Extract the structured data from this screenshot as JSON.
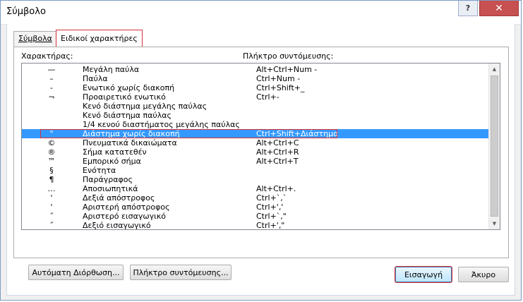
{
  "window": {
    "title": "Σύμβολο",
    "help_label": "?",
    "close_label": "✕"
  },
  "tabs": [
    {
      "label": "Σύμβολα"
    },
    {
      "label": "Ειδικοί χαρακτήρες"
    }
  ],
  "columns": {
    "character": "Χαρακτήρας:",
    "shortcut": "Πλήκτρο συντόμευσης:"
  },
  "rows": [
    {
      "char": "—",
      "name": "Μεγάλη παύλα",
      "key": "Alt+Ctrl+Num -"
    },
    {
      "char": "–",
      "name": "Παύλα",
      "key": "Ctrl+Num -"
    },
    {
      "char": "‑",
      "name": "Ενωτικό χωρίς διακοπή",
      "key": "Ctrl+Shift+_"
    },
    {
      "char": "¬",
      "name": "Προαιρετικό ενωτικό",
      "key": "Ctrl+-"
    },
    {
      "char": "",
      "name": "Κενό διάστημα μεγάλης παύλας",
      "key": ""
    },
    {
      "char": "",
      "name": "Κενό διάστημα παύλας",
      "key": ""
    },
    {
      "char": "",
      "name": "1/4 κενού διαστήματος μεγάλης παύλας",
      "key": ""
    },
    {
      "char": "°",
      "name": "Διάστημα χωρίς διακοπή",
      "key": "Ctrl+Shift+Διάστημα",
      "selected": true
    },
    {
      "char": "©",
      "name": "Πνευματικά δικαιώματα",
      "key": "Alt+Ctrl+C"
    },
    {
      "char": "®",
      "name": "Σήμα κατατεθέν",
      "key": "Alt+Ctrl+R"
    },
    {
      "char": "™",
      "name": "Εμπορικό σήμα",
      "key": "Alt+Ctrl+T"
    },
    {
      "char": "§",
      "name": "Ενότητα",
      "key": ""
    },
    {
      "char": "¶",
      "name": "Παράγραφος",
      "key": ""
    },
    {
      "char": "…",
      "name": "Αποσιωπητικά",
      "key": "Alt+Ctrl+."
    },
    {
      "char": "'",
      "name": "Δεξιά απόστροφος",
      "key": "Ctrl+`,`"
    },
    {
      "char": "'",
      "name": "Αριστερή απόστροφος",
      "key": "Ctrl+','"
    },
    {
      "char": "˝",
      "name": "Αριστερό εισαγωγικό",
      "key": "Ctrl+`,\""
    },
    {
      "char": "˝",
      "name": "Δεξιό εισαγωγικό",
      "key": "Ctrl+',\""
    }
  ],
  "buttons": {
    "autocorrect": "Αυτόματη Διόρθωση...",
    "shortcut": "Πλήκτρο συντόμευσης...",
    "insert": "Εισαγωγή",
    "cancel": "Άκυρο"
  }
}
